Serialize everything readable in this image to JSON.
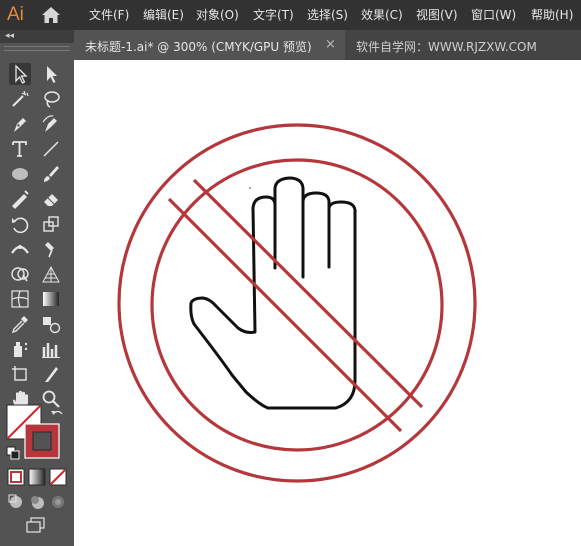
{
  "app": {
    "logo_text": "Ai",
    "brand_color": "#e48a3c"
  },
  "menu": {
    "file": "文件(F)",
    "edit": "编辑(E)",
    "object": "对象(O)",
    "type": "文字(T)",
    "select": "选择(S)",
    "effect": "效果(C)",
    "view": "视图(V)",
    "window": "窗口(W)",
    "help": "帮助(H)"
  },
  "tabs": {
    "active_title": "未标题-1.ai* @ 300% (CMYK/GPU 预览)",
    "close_glyph": "×",
    "other_title": "软件自学网：WWW.RJZXW.COM"
  },
  "toolbar": {
    "collapse_glyph": "◂◂",
    "tools": [
      "selection-tool",
      "direct-selection-tool",
      "magic-wand-tool",
      "lasso-tool",
      "pen-tool",
      "curvature-tool",
      "type-tool",
      "line-segment-tool",
      "ellipse-tool",
      "paintbrush-tool",
      "shaper-tool",
      "eraser-tool",
      "rotate-tool",
      "scale-tool",
      "width-tool",
      "puppet-warp-tool",
      "shape-builder-tool",
      "perspective-grid-tool",
      "mesh-tool",
      "gradient-tool",
      "eyedropper-tool",
      "blend-tool",
      "symbol-sprayer-tool",
      "column-graph-tool",
      "artboard-tool",
      "slice-tool",
      "hand-tool",
      "zoom-tool"
    ]
  },
  "artwork": {
    "ring_color": "#b5373c",
    "hand_color": "#111111"
  }
}
